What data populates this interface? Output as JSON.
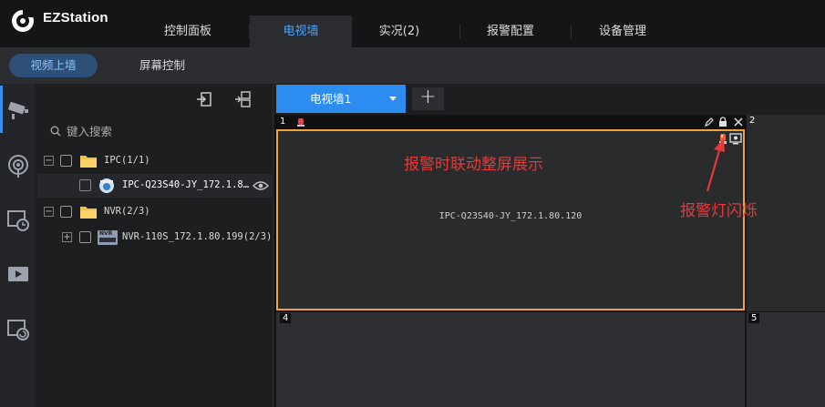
{
  "app": {
    "title": "EZStation",
    "logo_icon": "ezstation-logo-icon"
  },
  "header": {
    "tabs": [
      {
        "label": "控制面板",
        "active": false
      },
      {
        "label": "电视墙",
        "active": true
      },
      {
        "label": "实况(2)",
        "active": false
      },
      {
        "label": "报警配置",
        "active": false
      },
      {
        "label": "设备管理",
        "active": false
      }
    ]
  },
  "subnav": {
    "tabs": [
      {
        "label": "视频上墙",
        "active": true
      },
      {
        "label": "屏幕控制",
        "active": false
      }
    ]
  },
  "rail": {
    "icons": [
      "camera-icon",
      "alarm-input-icon",
      "playback-icon",
      "video-icon",
      "monitor-refresh-icon"
    ]
  },
  "tree": {
    "toolbar": [
      "export-icon",
      "layout-switch-icon"
    ],
    "search": {
      "placeholder": "键入搜索",
      "icon": "search-icon"
    },
    "rows": [
      {
        "label": "IPC(1/1)",
        "expander": "−",
        "type": "folder"
      },
      {
        "label": "IPC-Q23S40-JY_172.1.8…",
        "type": "camera",
        "selected": true
      },
      {
        "label": "NVR(2/3)",
        "expander": "−",
        "type": "folder"
      },
      {
        "label": "NVR-110S_172.1.80.199(2/3)",
        "expander": "+",
        "type": "nvr",
        "badge": "NVR"
      }
    ]
  },
  "wall": {
    "tab_label": "电视墙1",
    "add_label": "+",
    "windows": [
      {
        "number": "1",
        "camera": "IPC-Q23S40-JY_172.1.80.120",
        "alarm": true
      },
      {
        "number": "2"
      },
      {
        "number": "4"
      },
      {
        "number": "5"
      }
    ]
  },
  "annotations": {
    "fullscreen_note": "报警时联动整屏展示",
    "light_note": "报警灯闪烁",
    "color": "#e53a3a"
  },
  "colors": {
    "accent": "#2d8cf0",
    "alarm_border": "#f0a33a"
  }
}
